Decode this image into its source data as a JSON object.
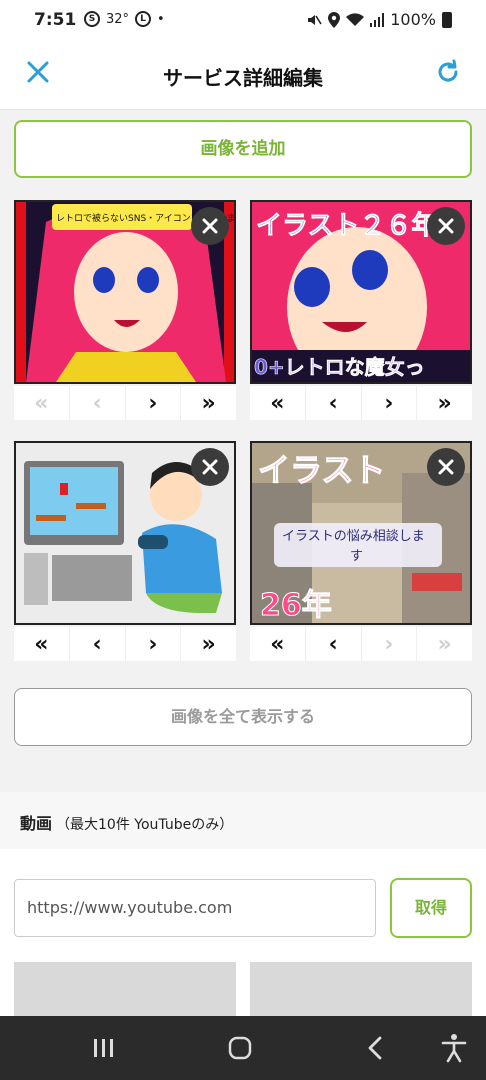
{
  "status": {
    "time": "7:51",
    "temp": "32°",
    "battery": "100%"
  },
  "header": {
    "title": "サービス詳細編集"
  },
  "images": {
    "add_label": "画像を追加",
    "show_all_label": "画像を全て表示する",
    "cards": [
      {
        "caption": "レトロで被らないSNS・アイコンを制作します。",
        "bottom_text": "",
        "nav": [
          "«",
          "‹",
          "›",
          "»"
        ],
        "disabled": [
          0,
          1
        ]
      },
      {
        "caption": "イラスト２６年",
        "bottom_text": "0+レトロな魔女っ",
        "nav": [
          "«",
          "‹",
          "›",
          "»"
        ],
        "disabled": []
      },
      {
        "caption": "",
        "bottom_text": "",
        "nav": [
          "«",
          "‹",
          "›",
          "»"
        ],
        "disabled": []
      },
      {
        "caption": "イラスト",
        "bottom_text": "26年",
        "mid_text": "イラストの悩み相談します",
        "nav": [
          "«",
          "‹",
          "›",
          "»"
        ],
        "disabled": [
          2,
          3
        ]
      }
    ]
  },
  "video": {
    "title": "動画",
    "note": "（最大10件 YouTubeのみ）",
    "url_value": "https://www.youtube.com",
    "fetch_label": "取得"
  }
}
